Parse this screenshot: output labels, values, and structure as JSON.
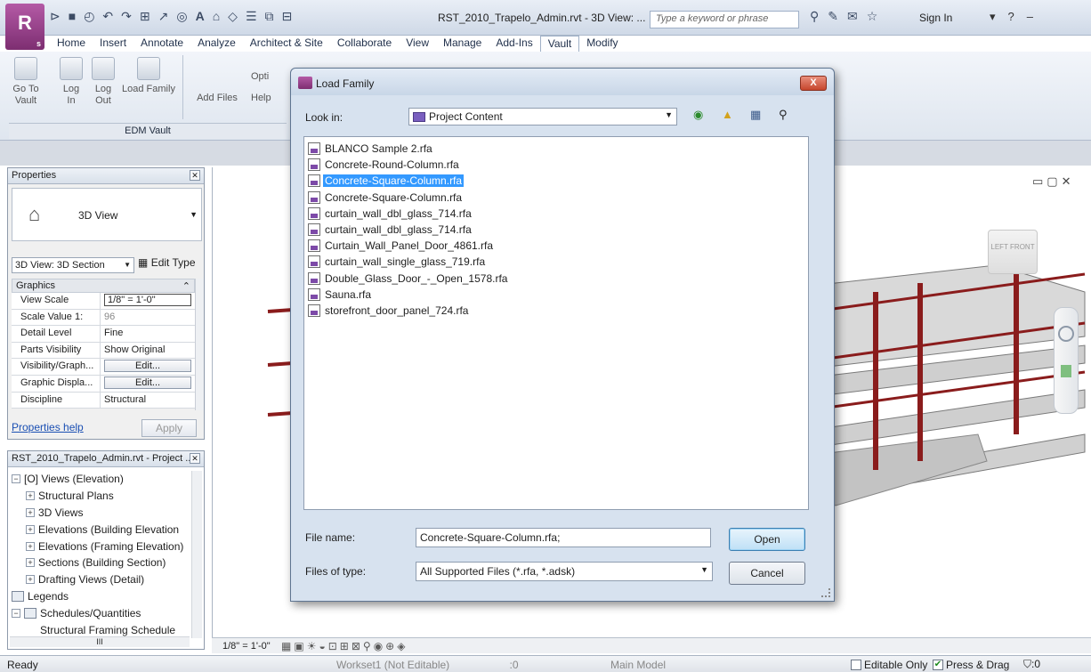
{
  "app": {
    "logo_letter": "R",
    "logo_sub": "s",
    "document_title": "RST_2010_Trapelo_Admin.rvt - 3D View: ...",
    "search_placeholder": "Type a keyword or phrase",
    "sign_in": "Sign In",
    "help_label": "?",
    "minimize_label": "–",
    "dropdown_label": "▾"
  },
  "ribbon": {
    "tabs": [
      "Home",
      "Insert",
      "Annotate",
      "Analyze",
      "Architect & Site",
      "Collaborate",
      "View",
      "Manage",
      "Add-Ins",
      "Vault",
      "Modify"
    ],
    "active_tab": "Vault",
    "buttons": {
      "go_to_vault": "Go To\nVault",
      "log_in": "Log\nIn",
      "log_out": "Log\nOut",
      "load_family": "Load Family",
      "add_files": "Add Files",
      "options": "Opti",
      "help": "Help"
    },
    "panel_label": "EDM Vault"
  },
  "properties": {
    "title": "Properties",
    "type_name": "3D View",
    "view_selector": "3D View: 3D Section",
    "edit_type": "Edit Type",
    "section": "Graphics",
    "rows": [
      {
        "key": "View Scale",
        "value": "1/8\" = 1'-0\""
      },
      {
        "key": "Scale Value    1:",
        "value": "96"
      },
      {
        "key": "Detail Level",
        "value": "Fine"
      },
      {
        "key": "Parts Visibility",
        "value": "Show Original"
      },
      {
        "key": "Visibility/Graph...",
        "value": "Edit..."
      },
      {
        "key": "Graphic Displa...",
        "value": "Edit..."
      },
      {
        "key": "Discipline",
        "value": "Structural"
      }
    ],
    "help_link": "Properties help",
    "apply": "Apply"
  },
  "browser": {
    "title": "RST_2010_Trapelo_Admin.rvt - Project ...",
    "nodes": [
      {
        "label": "[O] Views (Elevation)",
        "toggle": "−",
        "level": 0
      },
      {
        "label": "Structural Plans",
        "toggle": "+",
        "level": 1
      },
      {
        "label": "3D Views",
        "toggle": "+",
        "level": 1
      },
      {
        "label": "Elevations (Building Elevation",
        "toggle": "+",
        "level": 1
      },
      {
        "label": "Elevations (Framing Elevation)",
        "toggle": "+",
        "level": 1
      },
      {
        "label": "Sections (Building Section)",
        "toggle": "+",
        "level": 1
      },
      {
        "label": "Drafting Views (Detail)",
        "toggle": "+",
        "level": 1
      },
      {
        "label": "Legends",
        "toggle": "",
        "level": 0
      },
      {
        "label": "Schedules/Quantities",
        "toggle": "−",
        "level": 0
      },
      {
        "label": "Structural Framing Schedule",
        "toggle": "",
        "level": 2
      }
    ]
  },
  "viewport": {
    "scale": "1/8\" = 1'-0\"",
    "viewcube_left": "LEFT",
    "viewcube_front": "FRONT"
  },
  "statusbar": {
    "status": "Ready",
    "workset": "Workset1 (Not Editable)",
    "workset_count": ":0",
    "model": "Main Model",
    "editable_only": "Editable Only",
    "press_drag": "Press & Drag",
    "filter_count": ":0"
  },
  "dialog": {
    "title": "Load Family",
    "close_label": "X",
    "look_in_label": "Look in:",
    "look_in_value": "Project Content",
    "files": [
      "BLANCO Sample 2.rfa",
      "Concrete-Round-Column.rfa",
      "Concrete-Square-Column.rfa",
      "Concrete-Square-Column.rfa",
      "curtain_wall_dbl_glass_714.rfa",
      "curtain_wall_dbl_glass_714.rfa",
      "Curtain_Wall_Panel_Door_4861.rfa",
      "curtain_wall_single_glass_719.rfa",
      "Double_Glass_Door_-_Open_1578.rfa",
      "Sauna.rfa",
      "storefront_door_panel_724.rfa"
    ],
    "selected_index": 2,
    "file_name_label": "File name:",
    "file_name_value": "Concrete-Square-Column.rfa;",
    "files_of_type_label": "Files of type:",
    "files_of_type_value": "All Supported Files (*.rfa, *.adsk)",
    "open": "Open",
    "cancel": "Cancel"
  },
  "colors": {
    "accent": "#3399ff",
    "app_purple": "#8c3a80",
    "beam_red": "#8a1c1c"
  }
}
